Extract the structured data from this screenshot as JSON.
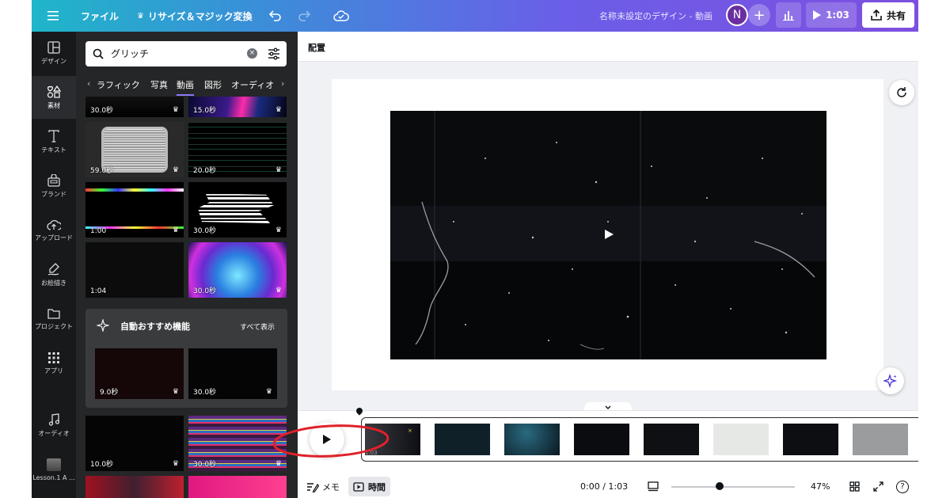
{
  "topbar": {
    "file_label": "ファイル",
    "resize_label": "リサイズ＆マジック変換",
    "doc_title": "名称未設定のデザイン - 動画",
    "avatar_initial": "N",
    "play_duration": "1:03",
    "share_label": "共有"
  },
  "sidenav": {
    "items": [
      {
        "label": "デザイン",
        "icon": "layout-icon"
      },
      {
        "label": "素材",
        "icon": "shapes-icon",
        "active": true
      },
      {
        "label": "テキスト",
        "icon": "text-icon"
      },
      {
        "label": "ブランド",
        "icon": "brand-icon"
      },
      {
        "label": "アップロード",
        "icon": "cloud-upload-icon"
      },
      {
        "label": "お絵描き",
        "icon": "draw-icon"
      },
      {
        "label": "プロジェクト",
        "icon": "folder-icon"
      },
      {
        "label": "アプリ",
        "icon": "apps-icon"
      },
      {
        "label": "オーディオ",
        "icon": "music-icon"
      },
      {
        "label": "Lesson.1 A ...",
        "icon": "project-thumb"
      }
    ]
  },
  "panel": {
    "search_query": "グリッチ",
    "tabs": [
      "ラフィック",
      "写真",
      "動画",
      "図形",
      "オーディオ"
    ],
    "active_tab": "動画",
    "thumbs": [
      {
        "duration": "30.0秒",
        "premium": true
      },
      {
        "duration": "15.0秒",
        "premium": true
      },
      {
        "duration": "59.0秒",
        "premium": true
      },
      {
        "duration": "20.0秒",
        "premium": true
      },
      {
        "duration": "1:00",
        "premium": true
      },
      {
        "duration": "30.0秒",
        "premium": true
      },
      {
        "duration": "1:04",
        "premium": false
      },
      {
        "duration": "30.0秒",
        "premium": true
      },
      {
        "duration": "10.0秒",
        "premium": true
      },
      {
        "duration": "30.0秒",
        "premium": true
      }
    ],
    "recommend": {
      "title": "自動おすすめ機能",
      "show_all": "すべて表示",
      "thumbs": [
        {
          "duration": "9.0秒",
          "premium": true
        },
        {
          "duration": "30.0秒",
          "premium": true
        }
      ]
    }
  },
  "editor": {
    "toolbar_label": "配置"
  },
  "timeline": {
    "time_display": "0:00 / 1:03",
    "zoom": "47%",
    "memo_label": "メモ",
    "time_label": "時間",
    "first_frame_label": "1:03"
  },
  "colors": {
    "accent": "#8b7cf6",
    "annotation_red": "#e0212a",
    "sidebar_bg": "#18191b",
    "panel_bg": "#252627"
  }
}
